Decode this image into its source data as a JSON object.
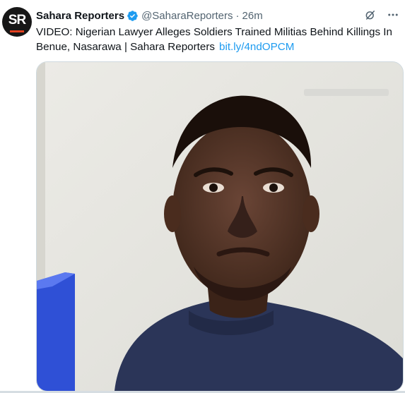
{
  "account": {
    "display_name": "Sahara Reporters",
    "handle": "@SaharaReporters",
    "separator": "·",
    "time": "26m",
    "avatar_text": "SR"
  },
  "tweet": {
    "text": "VIDEO: Nigerian Lawyer Alleges Soldiers Trained Militias Behind Killings In Benue, Nasarawa | Sahara Reporters",
    "link": "bit.ly/4ndOPCM"
  },
  "media": {
    "type": "video-still",
    "description_icon": "video-thumbnail"
  },
  "icons": {
    "grok": "grok-icon",
    "more": "more-icon",
    "verified": "verified-badge-icon"
  },
  "colors": {
    "link": "#1d9bf0",
    "verified": "#1d9bf0",
    "secondary_text": "#536471"
  }
}
